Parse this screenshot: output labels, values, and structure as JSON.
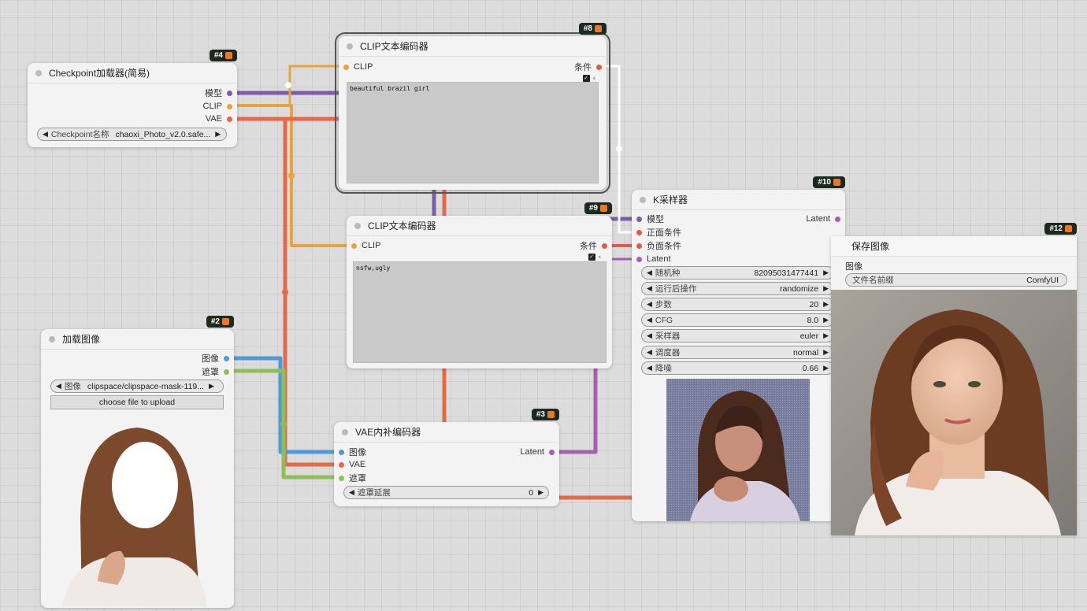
{
  "colors": {
    "model": "#7b5ea7",
    "clip": "#e8a33d",
    "vae": "#e46a4a",
    "image": "#4f9ad6",
    "mask": "#8cbf5a",
    "cond": "#e05a4c",
    "latent": "#a75fb0"
  },
  "nodes": {
    "checkpoint": {
      "badge": "#4",
      "title": "Checkpoint加载器(简易)",
      "out_model": "模型",
      "out_clip": "CLIP",
      "out_vae": "VAE",
      "ckpt_label": "Checkpoint名称",
      "ckpt_value": "chaoxi_Photo_v2.0.safe..."
    },
    "clip_pos": {
      "badge": "#8",
      "title": "CLIP文本编码器",
      "in_clip": "CLIP",
      "out_cond": "条件",
      "text": "beautiful brazil girl"
    },
    "clip_neg": {
      "badge": "#9",
      "title": "CLIP文本编码器",
      "in_clip": "CLIP",
      "out_cond": "条件",
      "text": "nsfw,ugly"
    },
    "ksampler": {
      "badge": "#10",
      "title": "K采样器",
      "in_model": "模型",
      "in_pos": "正面条件",
      "in_neg": "负面条件",
      "in_latent": "Latent",
      "out_latent": "Latent",
      "widgets": [
        {
          "label": "随机种",
          "value": "82095031477441"
        },
        {
          "label": "运行后操作",
          "value": "randomize"
        },
        {
          "label": "步数",
          "value": "20"
        },
        {
          "label": "CFG",
          "value": "8.0"
        },
        {
          "label": "采样器",
          "value": "euler"
        },
        {
          "label": "调度器",
          "value": "normal"
        },
        {
          "label": "降噪",
          "value": "0.66"
        }
      ]
    },
    "save": {
      "badge": "#12",
      "title": "保存图像",
      "in_image": "图像",
      "prefix_label": "文件名前缀",
      "prefix_value": "ComfyUI"
    },
    "load_image": {
      "badge": "#2",
      "title": "加载图像",
      "out_image": "图像",
      "out_mask": "遮罩",
      "image_label": "图像",
      "image_value": "clipspace/clipspace-mask-119...",
      "upload_label": "choose file to upload"
    },
    "vae_inpaint": {
      "badge": "#3",
      "title": "VAE内补编码器",
      "in_image": "图像",
      "in_vae": "VAE",
      "in_mask": "遮罩",
      "out_latent": "Latent",
      "grow_label": "遮罩延展",
      "grow_value": "0"
    }
  }
}
